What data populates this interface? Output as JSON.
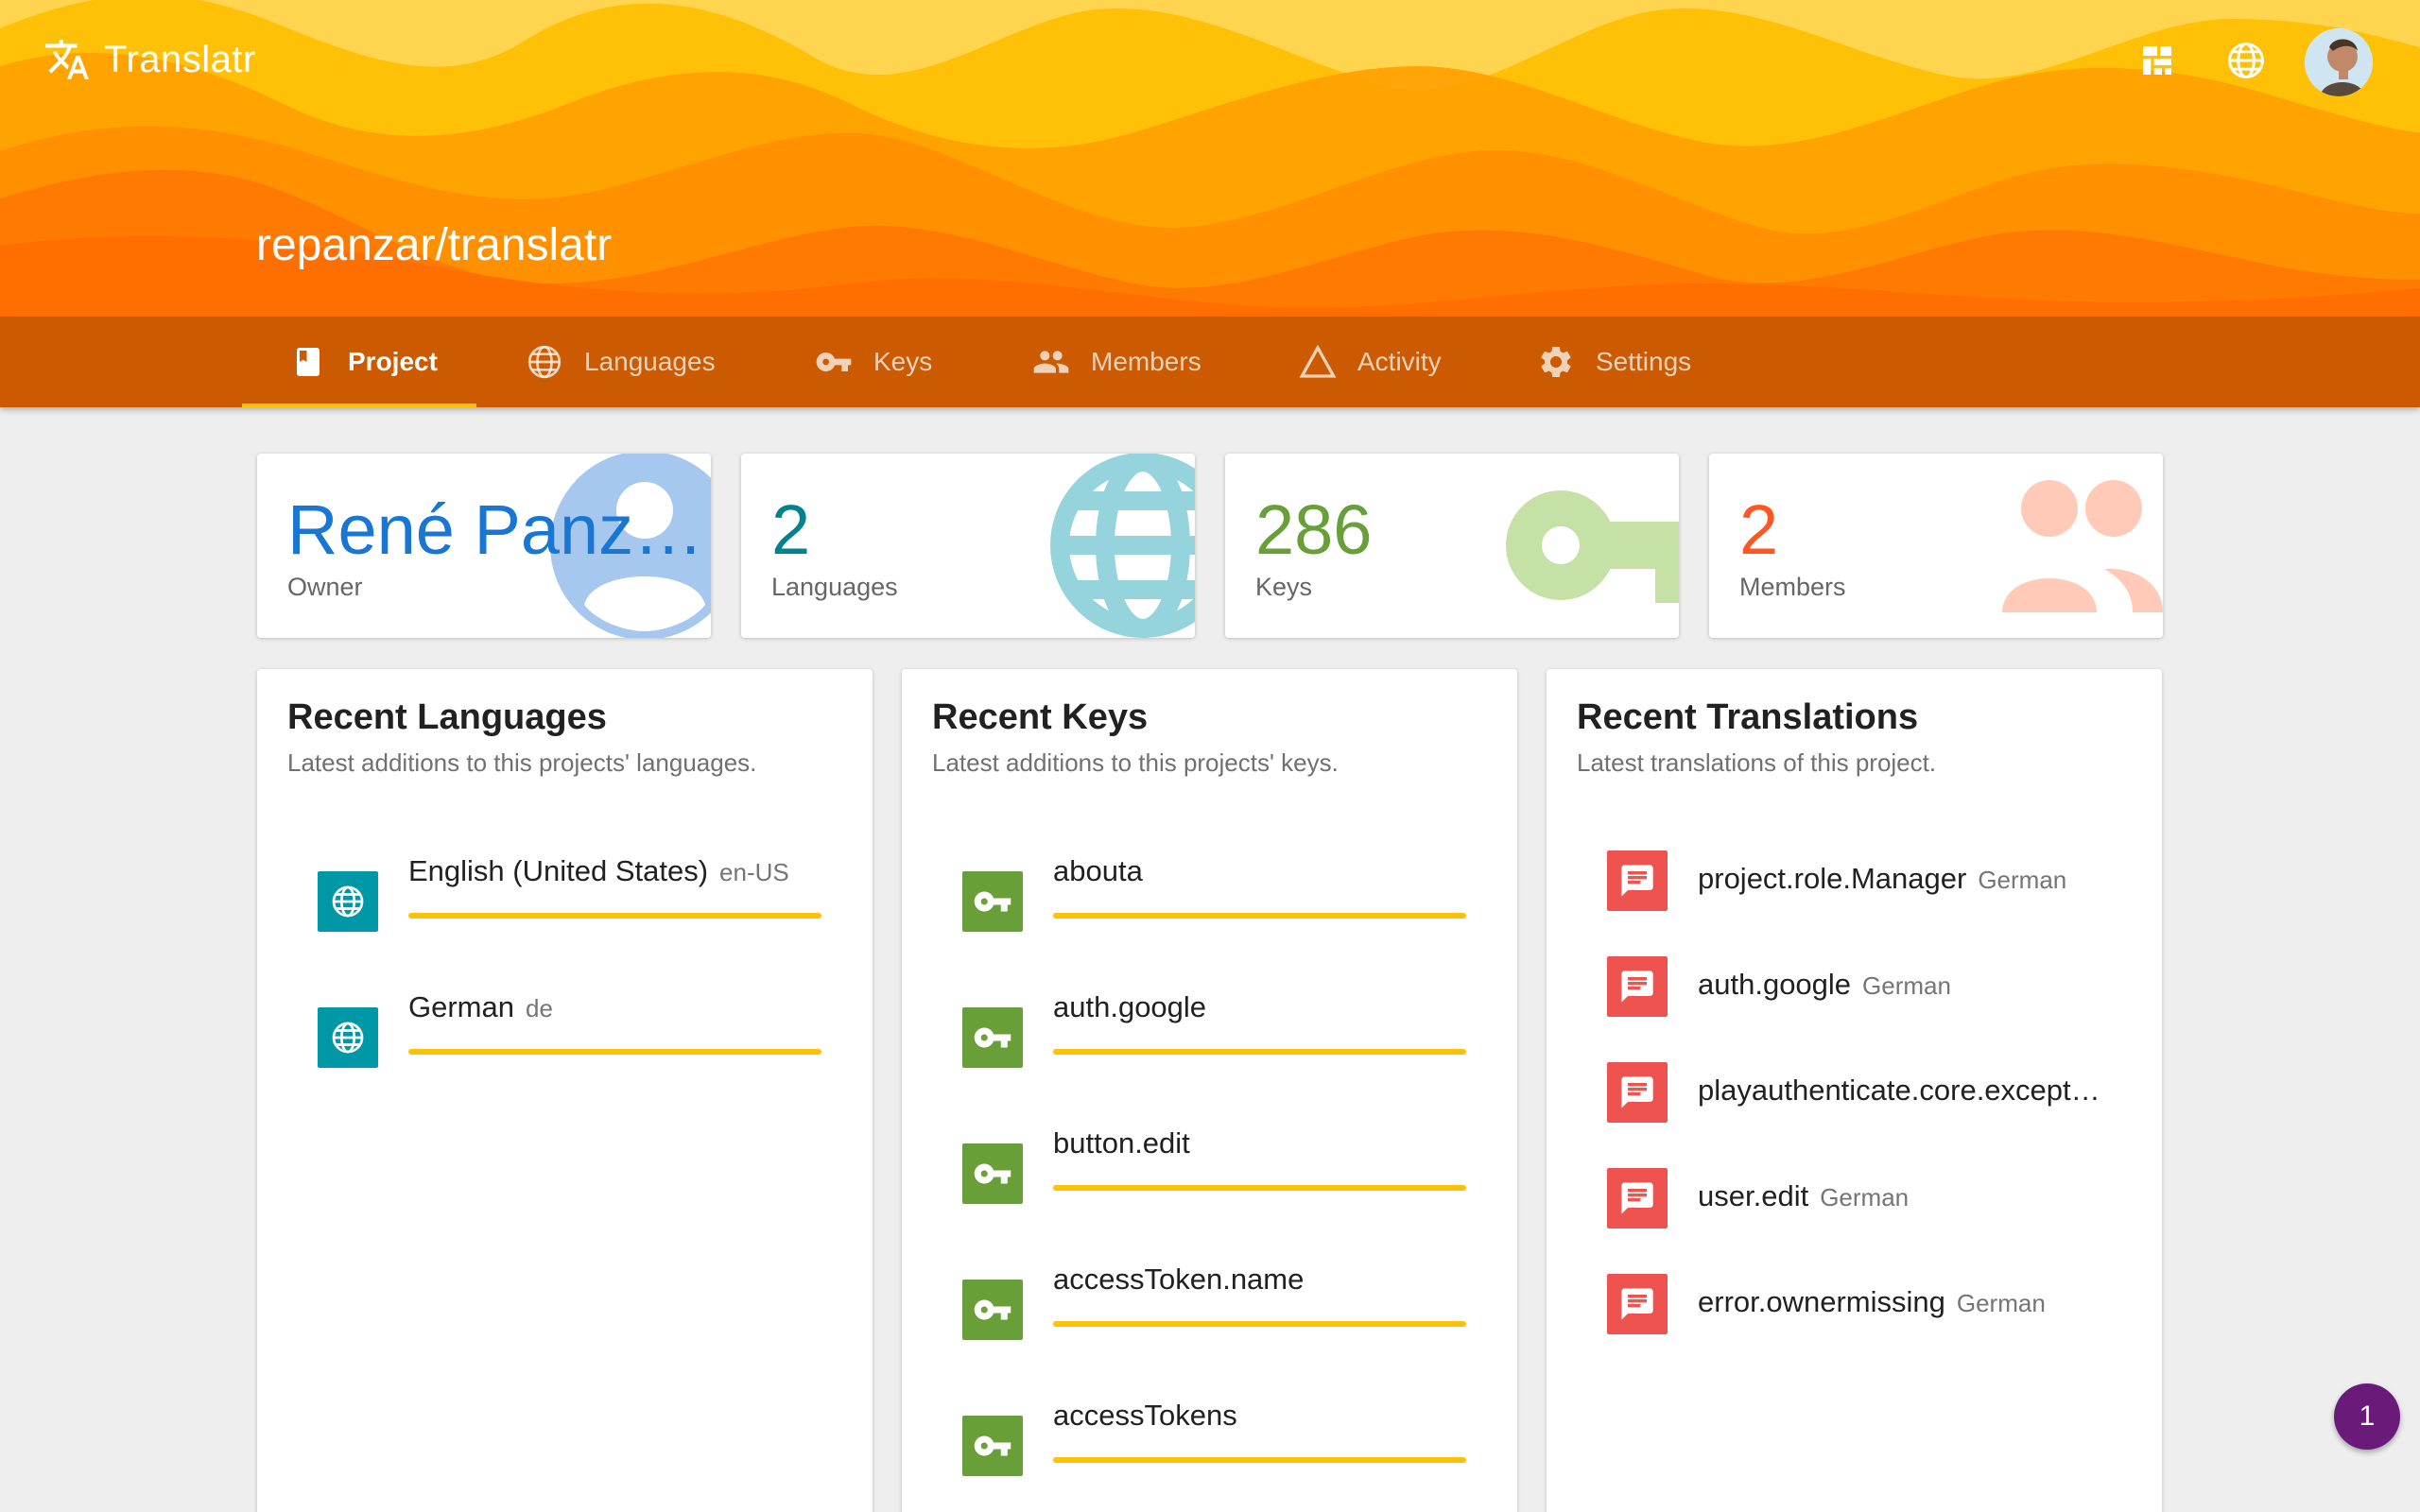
{
  "app": {
    "name": "Translatr"
  },
  "project": {
    "title": "repanzar/translatr"
  },
  "tabs": [
    {
      "label": "Project",
      "icon": "project-book-icon",
      "active": true
    },
    {
      "label": "Languages",
      "icon": "globe-icon"
    },
    {
      "label": "Keys",
      "icon": "key-icon"
    },
    {
      "label": "Members",
      "icon": "people-icon"
    },
    {
      "label": "Activity",
      "icon": "triangle-icon"
    },
    {
      "label": "Settings",
      "icon": "gear-icon"
    }
  ],
  "stats": {
    "owner": {
      "value": "René Panz…",
      "label": "Owner",
      "color": "#1976d2"
    },
    "languages": {
      "value": "2",
      "label": "Languages",
      "color": "#00838f"
    },
    "keys": {
      "value": "286",
      "label": "Keys",
      "color": "#689f38"
    },
    "members": {
      "value": "2",
      "label": "Members",
      "color": "#ff5722"
    }
  },
  "recent_languages": {
    "title": "Recent Languages",
    "description": "Latest additions to this projects' languages.",
    "items": [
      {
        "name": "English (United States)",
        "code": "en-US"
      },
      {
        "name": "German",
        "code": "de"
      }
    ]
  },
  "recent_keys": {
    "title": "Recent Keys",
    "description": "Latest additions to this projects' keys.",
    "items": [
      {
        "name": "abouta"
      },
      {
        "name": "auth.google"
      },
      {
        "name": "button.edit"
      },
      {
        "name": "accessToken.name"
      },
      {
        "name": "accessTokens"
      }
    ]
  },
  "recent_translations": {
    "title": "Recent Translations",
    "description": "Latest translations of this project.",
    "items": [
      {
        "key": "project.role.Manager",
        "language": "German"
      },
      {
        "key": "auth.google",
        "language": "German"
      },
      {
        "key": "playauthenticate.core.except…",
        "language": ""
      },
      {
        "key": "user.edit",
        "language": "German"
      },
      {
        "key": "error.ownermissing",
        "language": "German"
      }
    ]
  },
  "notifications": {
    "count": "1"
  },
  "colors": {
    "tab_bar": "#cc5a00",
    "tab_indicator": "#ffc107",
    "language_icon_bg": "#0097a7",
    "key_icon_bg": "#689f38",
    "translation_icon_bg": "#ef5350",
    "progress_bar": "#ffc107",
    "fab": "#6a1b7a"
  },
  "icons": {
    "brand": "translate-icon",
    "top_actions": [
      "dashboard-icon",
      "globe-icon",
      "user-avatar"
    ]
  }
}
